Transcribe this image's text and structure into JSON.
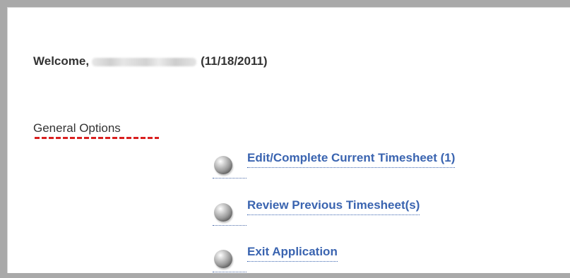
{
  "welcome": {
    "prefix": "Welcome,",
    "date": "(11/18/2011)"
  },
  "general_options": {
    "title": "General Options",
    "items": [
      {
        "label": "Edit/Complete Current Timesheet (1)",
        "icon": "sphere-bullet-icon"
      },
      {
        "label": "Review Previous Timesheet(s)",
        "icon": "sphere-bullet-icon"
      },
      {
        "label": "Exit Application",
        "icon": "sphere-bullet-icon"
      }
    ]
  },
  "colors": {
    "frame": "#a9a9a9",
    "link": "#3a64b0",
    "spellcheck_underline": "#d91f1f",
    "text": "#333333"
  }
}
